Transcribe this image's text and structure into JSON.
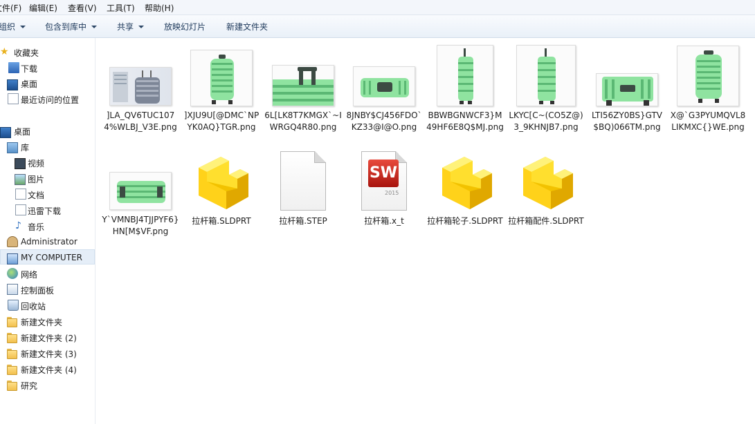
{
  "menu": [
    "文件(F)",
    "编辑(E)",
    "查看(V)",
    "工具(T)",
    "帮助(H)"
  ],
  "toolbar": {
    "organize": "组织",
    "include_library": "包含到库中",
    "share": "共享",
    "slideshow": "放映幻灯片",
    "new_folder": "新建文件夹"
  },
  "nav": {
    "favorites": "收藏夹",
    "downloads": "下载",
    "desktop_fav": "桌面",
    "recent": "最近访问的位置",
    "desktop": "桌面",
    "libraries": "库",
    "videos": "视频",
    "pictures": "图片",
    "documents": "文档",
    "thunder": "迅雷下载",
    "music": "音乐",
    "admin": "Administrator",
    "computer": "MY COMPUTER",
    "network": "网络",
    "control_panel": "控制面板",
    "recycle_bin": "回收站",
    "folder1": "新建文件夹",
    "folder2": "新建文件夹 (2)",
    "folder3": "新建文件夹 (3)",
    "folder4": "新建文件夹 (4)",
    "research": "研究"
  },
  "files": [
    {
      "name": "]LA_QV6TUC1074%WLBJ_V3E.png",
      "type": "image"
    },
    {
      "name": "]XJU9U[@DMC`NPYK0AQ}TGR.png",
      "type": "image"
    },
    {
      "name": "6L[LK8T7KMGX`~IWRGQ4R80.png",
      "type": "image"
    },
    {
      "name": "8JNBY$CJ456FDO`KZ33@I@O.png",
      "type": "image"
    },
    {
      "name": "BBWBGNWCF3}M49HF6E8Q$MJ.png",
      "type": "image"
    },
    {
      "name": "LKYC[C~(CO5Z@)3_9KHNJB7.png",
      "type": "image"
    },
    {
      "name": "LTI56ZY0BS}GTV$BQ)066TM.png",
      "type": "image"
    },
    {
      "name": "X@`G3PYUMQVL8LIKMXC{}WE.png",
      "type": "image"
    },
    {
      "name": "Y`VMNBJ4TJJPYF6}HN[M$VF.png",
      "type": "image"
    },
    {
      "name": "拉杆箱.SLDPRT",
      "type": "part"
    },
    {
      "name": "拉杆箱.STEP",
      "type": "doc"
    },
    {
      "name": "拉杆箱.x_t",
      "type": "sw",
      "logo": "SW",
      "year": "2015"
    },
    {
      "name": "拉杆箱轮子.SLDPRT",
      "type": "part"
    },
    {
      "name": "拉杆箱配件.SLDPRT",
      "type": "part"
    }
  ],
  "colors": {
    "suitcase_green": "#8fe3a0",
    "suitcase_dark": "#3c4a43",
    "part_yellow": "#ffd21a",
    "selection": "#e5eef8"
  }
}
